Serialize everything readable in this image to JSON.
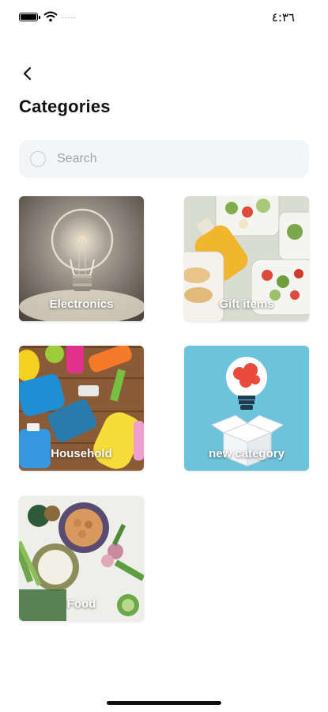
{
  "status_bar": {
    "time": "٤:٣٦",
    "carrier": "....."
  },
  "header": {
    "title": "Categories"
  },
  "search": {
    "placeholder": "Search",
    "value": ""
  },
  "categories": [
    {
      "label": "Electronics",
      "image": "light-bulb"
    },
    {
      "label": "Gift items",
      "image": "salad-containers"
    },
    {
      "label": "Household",
      "image": "cleaning-supplies"
    },
    {
      "label": "new category",
      "image": "idea-box"
    },
    {
      "label": "Food",
      "image": "grains-vegetables"
    }
  ],
  "colors": {
    "search_bg": "#f3f6f8",
    "placeholder": "#9aa3ab",
    "new_category_bg": "#6ec3dc"
  }
}
